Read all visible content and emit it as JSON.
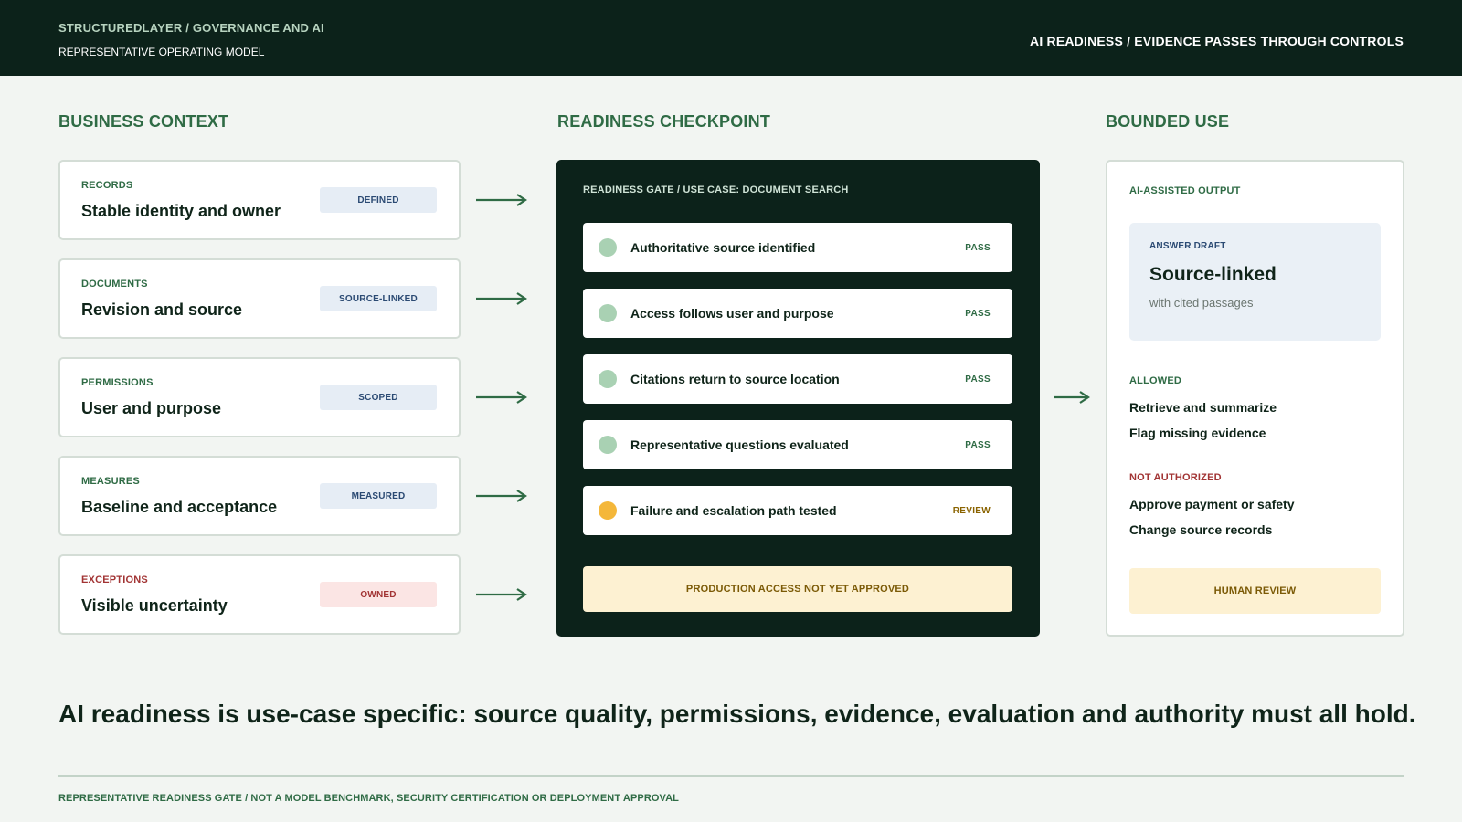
{
  "header": {
    "brand": "STRUCTUREDLAYER / GOVERNANCE AND AI",
    "subtitle": "REPRESENTATIVE OPERATING MODEL",
    "right": "AI READINESS / EVIDENCE PASSES THROUGH CONTROLS"
  },
  "columns": {
    "context": "BUSINESS CONTEXT",
    "checkpoint": "READINESS CHECKPOINT",
    "bounded": "BOUNDED USE"
  },
  "context_cards": [
    {
      "label": "RECORDS",
      "title": "Stable identity and owner",
      "badge": "DEFINED",
      "tone": "normal"
    },
    {
      "label": "DOCUMENTS",
      "title": "Revision and source",
      "badge": "SOURCE-LINKED",
      "tone": "normal"
    },
    {
      "label": "PERMISSIONS",
      "title": "User and purpose",
      "badge": "SCOPED",
      "tone": "normal"
    },
    {
      "label": "MEASURES",
      "title": "Baseline and acceptance",
      "badge": "MEASURED",
      "tone": "normal"
    },
    {
      "label": "EXCEPTIONS",
      "title": "Visible uncertainty",
      "badge": "OWNED",
      "tone": "warn"
    }
  ],
  "gate": {
    "label": "READINESS GATE / USE CASE: DOCUMENT SEARCH",
    "checks": [
      {
        "text": "Authoritative source identified",
        "status": "PASS"
      },
      {
        "text": "Access follows user and purpose",
        "status": "PASS"
      },
      {
        "text": "Citations return to source location",
        "status": "PASS"
      },
      {
        "text": "Representative questions evaluated",
        "status": "PASS"
      },
      {
        "text": "Failure and escalation path tested",
        "status": "REVIEW"
      }
    ],
    "banner": "PRODUCTION ACCESS NOT YET APPROVED"
  },
  "output": {
    "label": "AI-ASSISTED OUTPUT",
    "draft_label": "ANSWER DRAFT",
    "draft_title": "Source-linked",
    "draft_sub": "with cited passages",
    "allowed_label": "ALLOWED",
    "allowed": [
      "Retrieve and summarize",
      "Flag missing evidence"
    ],
    "not_label": "NOT AUTHORIZED",
    "not_authorized": [
      "Approve payment or safety",
      "Change source records"
    ],
    "human": "HUMAN REVIEW"
  },
  "headline": "AI readiness is use-case specific: source quality, permissions, evidence, evaluation and authority must all hold.",
  "footnote": "REPRESENTATIVE READINESS GATE / NOT A MODEL BENCHMARK, SECURITY CERTIFICATION OR DEPLOYMENT APPROVAL",
  "colors": {
    "dark": "#0c221a",
    "accent": "#2f6b45",
    "pass": "#a9d1b3",
    "review": "#f4b73a",
    "warn": "#a23434"
  },
  "icons": {
    "arrow": "arrow-right-icon",
    "status_dot": "status-dot-icon"
  }
}
